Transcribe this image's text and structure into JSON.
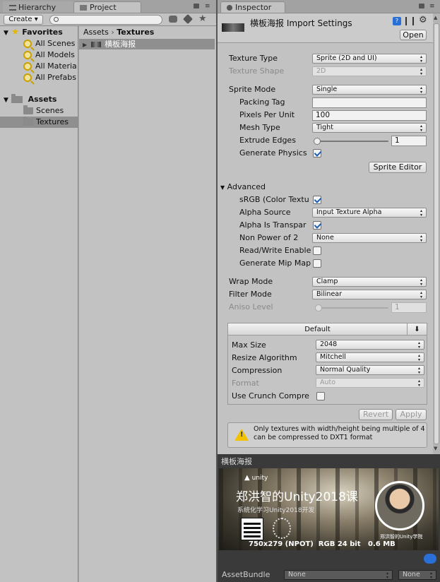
{
  "tabs": {
    "hierarchy": "Hierarchy",
    "project": "Project",
    "inspector": "Inspector"
  },
  "project": {
    "create_label": "Create ▾",
    "search_placeholder": "",
    "favorites_label": "Favorites",
    "favorites": [
      "All Scenes",
      "All Models",
      "All Materia",
      "All Prefabs"
    ],
    "assets_label": "Assets",
    "folders": [
      "Scenes",
      "Textures"
    ],
    "breadcrumb_root": "Assets",
    "breadcrumb_sep": "›",
    "breadcrumb_current": "Textures",
    "file_name": "横板海报"
  },
  "inspector": {
    "title": "横板海报 Import Settings",
    "open_label": "Open",
    "texture_type_label": "Texture Type",
    "texture_type_value": "Sprite (2D and UI)",
    "texture_shape_label": "Texture Shape",
    "texture_shape_value": "2D",
    "sprite_mode_label": "Sprite Mode",
    "sprite_mode_value": "Single",
    "packing_tag_label": "Packing Tag",
    "packing_tag_value": "",
    "ppu_label": "Pixels Per Unit",
    "ppu_value": "100",
    "mesh_type_label": "Mesh Type",
    "mesh_type_value": "Tight",
    "extrude_label": "Extrude Edges",
    "extrude_value": "1",
    "gen_physics_label": "Generate Physics",
    "sprite_editor_label": "Sprite Editor",
    "advanced_label": "Advanced",
    "srgb_label": "sRGB (Color Textu",
    "alpha_source_label": "Alpha Source",
    "alpha_source_value": "Input Texture Alpha",
    "alpha_transp_label": "Alpha Is Transpar",
    "npot_label": "Non Power of 2",
    "npot_value": "None",
    "rw_label": "Read/Write Enable",
    "mipmap_label": "Generate Mip Map",
    "wrap_label": "Wrap Mode",
    "wrap_value": "Clamp",
    "filter_label": "Filter Mode",
    "filter_value": "Bilinear",
    "aniso_label": "Aniso Level",
    "aniso_value": "1",
    "platform_tab": "Default",
    "max_size_label": "Max Size",
    "max_size_value": "2048",
    "resize_label": "Resize Algorithm",
    "resize_value": "Mitchell",
    "compression_label": "Compression",
    "compression_value": "Normal Quality",
    "format_label": "Format",
    "format_value": "Auto",
    "crunch_label": "Use Crunch Compre",
    "revert_label": "Revert",
    "apply_label": "Apply",
    "warning_text": "Only textures with width/height being multiple of 4 can be compressed to DXT1 format"
  },
  "preview": {
    "title": "横板海报",
    "unity_logo": "unity",
    "headline": "郑洪智的Unity2018课",
    "subtitle": "系统化学习Unity2018开发",
    "avatar_caption": "郑洪智的Unity学院",
    "info": "750x279 (NPOT)  RGB 24 bit   0.6 MB"
  },
  "assetbundle": {
    "label": "AssetBundle",
    "name_value": "None",
    "variant_value": "None"
  },
  "colors": {
    "panel": "#c2c2c2",
    "selection": "#8f8f8f",
    "accent_blue": "#2a6fd6",
    "warning_yellow": "#f2c200"
  }
}
